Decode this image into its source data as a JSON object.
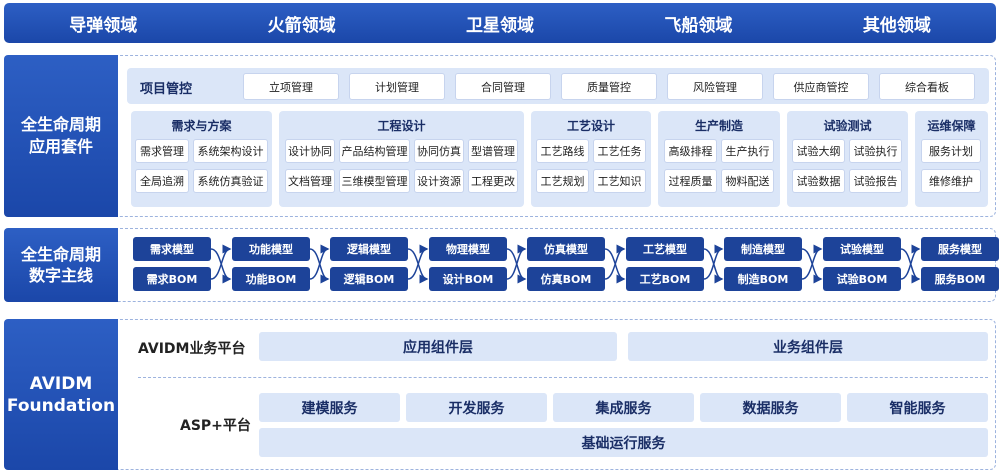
{
  "domains": [
    "导弹领域",
    "火箭领域",
    "卫星领域",
    "飞船领域",
    "其他领域"
  ],
  "suite": {
    "title_line1": "全生命周期",
    "title_line2": "应用套件",
    "project": {
      "title": "项目管控",
      "items": [
        "立项管理",
        "计划管理",
        "合同管理",
        "质量管控",
        "风险管理",
        "供应商管控",
        "综合看板"
      ]
    },
    "groups": [
      {
        "title": "需求与方案",
        "items": [
          "需求管理",
          "系统架构设计",
          "全局追溯",
          "系统仿真验证"
        ]
      },
      {
        "title": "工程设计",
        "items": [
          "设计协同",
          "产品结构管理",
          "协同仿真",
          "型谱管理",
          "文档管理",
          "三维模型管理",
          "设计资源",
          "工程更改"
        ]
      },
      {
        "title": "工艺设计",
        "items": [
          "工艺路线",
          "工艺任务",
          "工艺规划",
          "工艺知识"
        ]
      },
      {
        "title": "生产制造",
        "items": [
          "高级排程",
          "生产执行",
          "过程质量",
          "物料配送"
        ]
      },
      {
        "title": "试验测试",
        "items": [
          "试验大纲",
          "试验执行",
          "试验数据",
          "试验报告"
        ]
      },
      {
        "title": "运维保障",
        "items": [
          "服务计划",
          "维修维护"
        ]
      }
    ]
  },
  "thread": {
    "title_line1": "全生命周期",
    "title_line2": "数字主线",
    "top": [
      "需求模型",
      "功能模型",
      "逻辑模型",
      "物理模型",
      "仿真模型",
      "工艺模型",
      "制造模型",
      "试验模型",
      "服务模型"
    ],
    "bottom": [
      "需求BOM",
      "功能BOM",
      "逻辑BOM",
      "设计BOM",
      "仿真BOM",
      "工艺BOM",
      "制造BOM",
      "试验BOM",
      "服务BOM"
    ]
  },
  "foundation": {
    "title_line1": "AVIDM",
    "title_line2": "Foundation",
    "business_platform": "AVIDM业务平台",
    "app_layer": "应用组件层",
    "biz_layer": "业务组件层",
    "asp_platform": "ASP+平台",
    "services": [
      "建模服务",
      "开发服务",
      "集成服务",
      "数据服务",
      "智能服务"
    ],
    "base": "基础运行服务"
  }
}
